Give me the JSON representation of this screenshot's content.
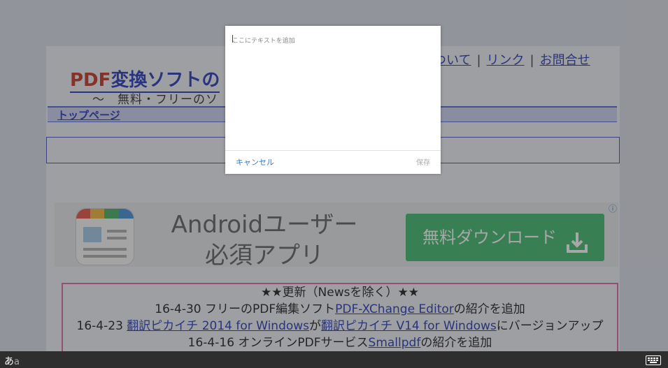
{
  "nav": {
    "link1": "ついて",
    "link2": "リンク",
    "link3": "お問合せ",
    "sep": "|"
  },
  "header": {
    "logo_pdf": "PDF",
    "logo_rest": "変換ソフトの",
    "tagline": "～　無料・フリーのソ"
  },
  "topbar": {
    "label": "トップページ"
  },
  "ad": {
    "line1": "Androidユーザー",
    "line2": "必須アプリ",
    "button": "無料ダウンロード",
    "info": "ⓘ"
  },
  "news": {
    "title": "★★更新（Newsを除く）★★",
    "items": [
      {
        "prefix": "16-4-30 フリーのPDF編集ソフト",
        "link": "PDF-XChange Editor",
        "suffix": "の紹介を追加"
      },
      {
        "prefix": "16-4-23 ",
        "link": "翻訳ピカイチ 2014 for Windows",
        "mid": "が",
        "link2": "翻訳ピカイチ V14 for Windows",
        "suffix": "にバージョンアップ"
      },
      {
        "prefix": "16-4-16 オンラインPDFサービス",
        "link": "Smallpdf",
        "suffix": "の紹介を追加"
      }
    ]
  },
  "dialog": {
    "placeholder": "ここにテキストを追加",
    "cancel": "キャンセル",
    "save": "保存"
  },
  "keyboard": {
    "ime_hira": "あ",
    "ime_latin": "a"
  },
  "colors": {
    "accent": "#2b7ad1",
    "ad_button": "#35b768",
    "link": "#1a2fb0"
  }
}
